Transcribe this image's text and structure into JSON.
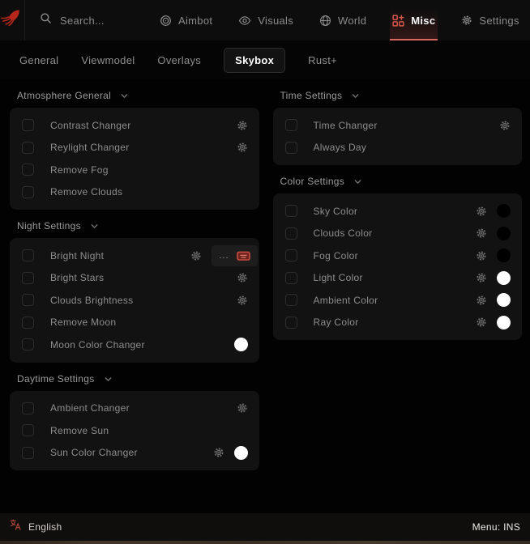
{
  "header": {
    "logo": "squid-logo",
    "search": {
      "placeholder": "Search..."
    },
    "nav": [
      {
        "id": "aimbot",
        "label": "Aimbot",
        "icon": "target-icon",
        "active": false
      },
      {
        "id": "visuals",
        "label": "Visuals",
        "icon": "eye-icon",
        "active": false
      },
      {
        "id": "world",
        "label": "World",
        "icon": "globe-icon",
        "active": false
      },
      {
        "id": "misc",
        "label": "Misc",
        "icon": "grid-plus-icon",
        "active": true
      },
      {
        "id": "settings",
        "label": "Settings",
        "icon": "gear-icon",
        "active": false
      }
    ]
  },
  "tabs": [
    {
      "label": "General",
      "active": false
    },
    {
      "label": "Viewmodel",
      "active": false
    },
    {
      "label": "Overlays",
      "active": false
    },
    {
      "label": "Skybox",
      "active": true
    },
    {
      "label": "Rust+",
      "active": false
    }
  ],
  "columns": {
    "left": [
      {
        "title": "Atmosphere General",
        "rows": [
          {
            "label": "Contrast Changer",
            "checked": false,
            "controls": [
              "gear"
            ]
          },
          {
            "label": "Reylight Changer",
            "checked": false,
            "controls": [
              "gear"
            ]
          },
          {
            "label": "Remove Fog",
            "checked": false,
            "controls": []
          },
          {
            "label": "Remove Clouds",
            "checked": false,
            "controls": []
          }
        ]
      },
      {
        "title": "Night Settings",
        "rows": [
          {
            "label": "Bright Night",
            "checked": false,
            "controls": [
              "gear",
              "bind"
            ],
            "bind_text": "..."
          },
          {
            "label": "Bright Stars",
            "checked": false,
            "controls": [
              "gear"
            ]
          },
          {
            "label": "Clouds Brightness",
            "checked": false,
            "controls": [
              "gear"
            ]
          },
          {
            "label": "Remove Moon",
            "checked": false,
            "controls": []
          },
          {
            "label": "Moon Color Changer",
            "checked": false,
            "controls": [
              "swatch"
            ],
            "swatch": "#ffffff"
          }
        ]
      },
      {
        "title": "Daytime Settings",
        "rows": [
          {
            "label": "Ambient Changer",
            "checked": false,
            "controls": [
              "gear"
            ]
          },
          {
            "label": "Remove Sun",
            "checked": false,
            "controls": []
          },
          {
            "label": "Sun Color Changer",
            "checked": false,
            "controls": [
              "gear",
              "swatch"
            ],
            "swatch": "#ffffff"
          }
        ]
      }
    ],
    "right": [
      {
        "title": "Time Settings",
        "rows": [
          {
            "label": "Time Changer",
            "checked": false,
            "controls": [
              "gear"
            ]
          },
          {
            "label": "Always Day",
            "checked": false,
            "controls": []
          }
        ]
      },
      {
        "title": "Color Settings",
        "rows": [
          {
            "label": "Sky Color",
            "checked": false,
            "controls": [
              "gear",
              "swatch"
            ],
            "swatch": "#000000"
          },
          {
            "label": "Clouds Color",
            "checked": false,
            "controls": [
              "gear",
              "swatch"
            ],
            "swatch": "#000000"
          },
          {
            "label": "Fog Color",
            "checked": false,
            "controls": [
              "gear",
              "swatch"
            ],
            "swatch": "#000000"
          },
          {
            "label": "Light Color",
            "checked": false,
            "controls": [
              "gear",
              "swatch"
            ],
            "swatch": "#ffffff"
          },
          {
            "label": "Ambient Color",
            "checked": false,
            "controls": [
              "gear",
              "swatch"
            ],
            "swatch": "#ffffff"
          },
          {
            "label": "Ray Color",
            "checked": false,
            "controls": [
              "gear",
              "swatch"
            ],
            "swatch": "#ffffff"
          }
        ]
      }
    ]
  },
  "footer": {
    "language": "English",
    "menu_bind": "Menu: INS"
  },
  "colors": {
    "accent_red": "#d4564c",
    "underline_red": "#d96a60",
    "logo_red": "#b6261c",
    "bind_red": "#c84b40",
    "swatch_white": "#ffffff",
    "swatch_black": "#000000"
  }
}
